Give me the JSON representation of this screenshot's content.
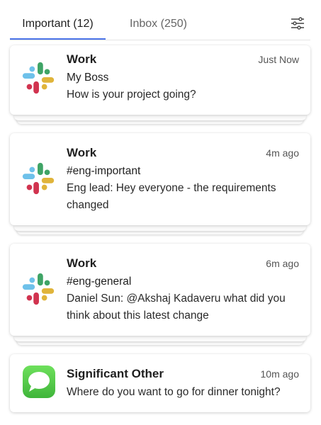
{
  "tabs": {
    "important_label": "Important (12)",
    "inbox_label": "Inbox (250)",
    "filter_icon": "sliders-icon"
  },
  "notifications": [
    {
      "app": "slack",
      "title": "Work",
      "time": "Just Now",
      "channel": "My Boss",
      "message": "How is your project going?"
    },
    {
      "app": "slack",
      "title": "Work",
      "time": "4m ago",
      "channel": "#eng-important",
      "message": "Eng lead: Hey everyone - the requirements changed"
    },
    {
      "app": "slack",
      "title": "Work",
      "time": "6m ago",
      "channel": "#eng-general",
      "message": "Daniel Sun: @Akshaj Kadaveru what did you think about this latest change"
    },
    {
      "app": "messages",
      "title": "Significant Other",
      "time": "10m ago",
      "message": "Where do you want to go for dinner tonight?"
    }
  ],
  "colors": {
    "accent": "#4a73e8",
    "slack_blue": "#36c5f0",
    "slack_green": "#2eb67d",
    "slack_red": "#e01e5a",
    "slack_yellow": "#ecb22e",
    "messages_green": "#4cd964"
  }
}
